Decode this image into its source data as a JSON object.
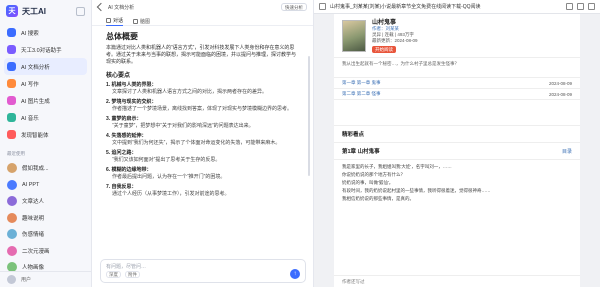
{
  "app": {
    "name": "天工AI"
  },
  "sidebar": {
    "nav": [
      {
        "label": "AI 搜索",
        "color": "#3b6cff"
      },
      {
        "label": "天工3.0对话助手",
        "color": "#7a5cff"
      },
      {
        "label": "AI 文档分析",
        "color": "#3b6cff"
      },
      {
        "label": "AI 写作",
        "color": "#ff8a3b"
      },
      {
        "label": "AI 图片生成",
        "color": "#e25bd0"
      },
      {
        "label": "AI 音乐",
        "color": "#2fb59a"
      },
      {
        "label": "发现智能体",
        "color": "#ff5b5b"
      }
    ],
    "section_label": "最近使用",
    "agents": [
      {
        "label": "假如我成...",
        "color": "#d6a36b"
      },
      {
        "label": "AI PPT",
        "color": "#4b7bff"
      },
      {
        "label": "文章达人",
        "color": "#8c6bd9"
      },
      {
        "label": "趣味说明",
        "color": "#e58a5b"
      },
      {
        "label": "伤感情绪",
        "color": "#6bb0d6"
      },
      {
        "label": "二次元漫画",
        "color": "#e56bb0"
      },
      {
        "label": "人物画像",
        "color": "#7bc27b"
      }
    ],
    "user": "用户"
  },
  "chat": {
    "header_title": "AI 文档分析",
    "share_label": "快速分析",
    "tabs": [
      "对话",
      "脑图"
    ],
    "doc_title": "总体概要",
    "lead": "本篇通过对比人类和机器人的“语言方式”，引发对科技发展下人类身份和存在意义的思考。通过关于未来与当事的联想，揭示可能面临的困境，并以提问与推理，探讨教学与现实的联系。",
    "points_title": "核心要点",
    "points": [
      {
        "t": "1. 机械与人类的界限：",
        "d": "文章探讨了人类和机器人语言方式之间的对比，揭示两者存在的差异。"
      },
      {
        "t": "2. 梦境与现实的交织：",
        "d": "作者描述了一个梦境场景，离线找到答案，体现了对现实与梦境模糊边界的思考。"
      },
      {
        "t": "3. 童梦的启示：",
        "d": "“关于童梦”，把梦想中“关于对我们的影响深远”的问题表达出来。"
      },
      {
        "t": "4. 失落感的延伸：",
        "d": "文中提到“我们为何还失”，揭示了个体面对命运变化的失落，可能带来麻木。"
      },
      {
        "t": "5. 追问之路：",
        "d": "“我们又该如何面对”提出了思考关于生存的反思。"
      },
      {
        "t": "6. 模糊的边缘地带：",
        "d": "作者最后提出问题，认为存在一个“推开门”的困境。"
      },
      {
        "t": "7. 自我反思：",
        "d": "通过个人经历（从事梦境工作），引发对前途的思考。"
      }
    ],
    "composer_placeholder": "有问题，尽管问…",
    "chips": [
      "深度",
      "附件"
    ],
    "send_glyph": "↑"
  },
  "web": {
    "tab_title": "山村鬼事_刘某某(刘某)小说最新章节全文免费在线阅读下载-QQ阅读",
    "book_title": "山村鬼事",
    "book_author": "作者：刘某某",
    "book_meta": "灵异 | 连载 | 493万字",
    "book_update": "最新更新：2024-08-09",
    "read_btn": "开始阅读",
    "blurb": "我从出生起就有一个秘密…，为什么村子里总是发生怪事？",
    "list_rows": [
      {
        "left": "第一章 第一章 鬼事",
        "right": "2024-08-09"
      },
      {
        "left": "第二章 第二章 怪事",
        "right": "2024-08-09"
      }
    ],
    "section": "精彩看点",
    "chapter_name": "第1章 山村鬼事",
    "chapter_btn": "目录",
    "body_lines": [
      "我是家里的长子，我姐姐叫我'大娃'，名字叫刘一，……",
      "你说奶奶说的那个地方有什么？",
      "奶奶说的事，叫做'狐仙'。",
      "有段时间，我的奶奶说起村里的一些事情，我听得很着迷，觉得很神奇……",
      "我相信奶奶说的那些事情，是真的。"
    ],
    "footer": "作者还写过"
  }
}
